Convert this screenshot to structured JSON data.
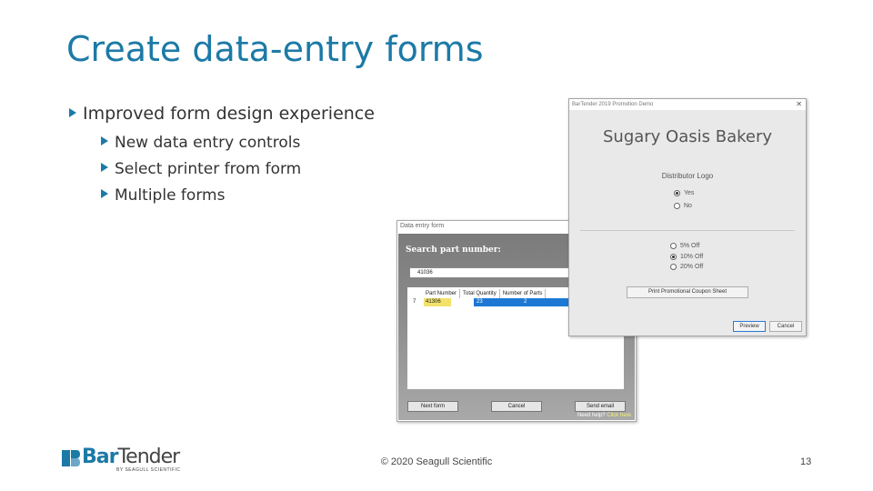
{
  "slide": {
    "title": "Create data-entry forms",
    "bullets": {
      "main": "Improved form design experience",
      "sub": [
        "New data entry controls",
        "Select printer from form",
        "Multiple forms"
      ]
    }
  },
  "data_entry_window": {
    "title": "Data entry form",
    "search_label": "Search part number:",
    "part_input_value": "41036",
    "columns": [
      "Part Number",
      "Total Quantity",
      "Number of Parts"
    ],
    "row": {
      "index": "7",
      "part": "41306",
      "quantity": "23",
      "parts": "2"
    },
    "buttons": {
      "next": "Next form",
      "cancel": "Cancel",
      "send": "Send email"
    },
    "help_text": "Need help?",
    "help_link": "Click here"
  },
  "promo_window": {
    "title": "BarTender 2019 Promotion Demo",
    "close_glyph": "✕",
    "company": "Sugary Oasis Bakery",
    "logo_label": "Distributor Logo",
    "logo_options": [
      {
        "label": "Yes",
        "selected": true
      },
      {
        "label": "No",
        "selected": false
      }
    ],
    "discount_options": [
      {
        "label": "5% Off",
        "selected": false
      },
      {
        "label": "10% Off",
        "selected": true
      },
      {
        "label": "20% Off",
        "selected": false
      }
    ],
    "coupon_button": "Print Promotional Coupon Sheet",
    "preview_button": "Preview",
    "cancel_button": "Cancel"
  },
  "footer": {
    "logo_bar": "Bar",
    "logo_tender": "Tender",
    "logo_sub": "BY SEAGULL SCIENTIFIC",
    "copyright": "© 2020 Seagull Scientific",
    "page_number": "13"
  },
  "colors": {
    "accent": "#1c7aa6",
    "selection": "#1c78d4",
    "highlight": "#f2e26a"
  }
}
